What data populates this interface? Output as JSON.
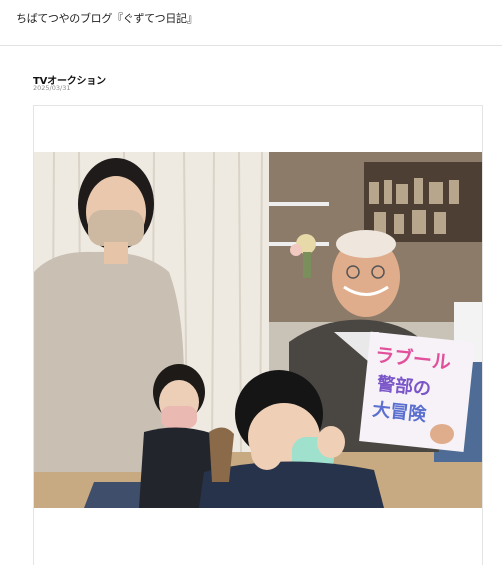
{
  "header": {
    "blog_title": "ちばてつやのブログ『ぐずてつ日記』"
  },
  "entry": {
    "title": "TVオークション",
    "date": "2025/03/31",
    "photo": {
      "sign_lines": [
        "ラブール",
        "警部の",
        "大冒険"
      ]
    }
  }
}
